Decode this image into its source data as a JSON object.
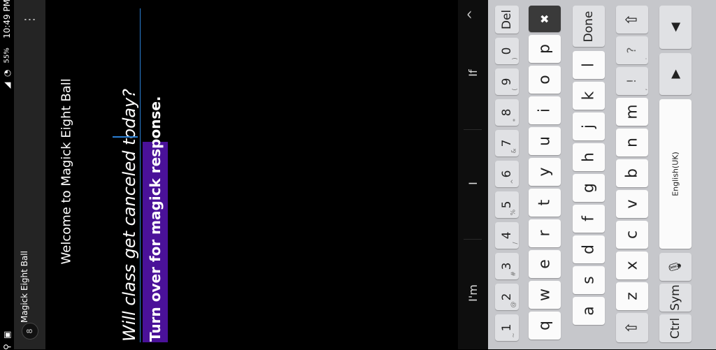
{
  "status_bar": {
    "time": "10:49 PM",
    "battery": "55%"
  },
  "app": {
    "title": "Magick Eight Ball",
    "logo_text": "8",
    "menu_icon": "overflow-menu-icon"
  },
  "content": {
    "welcome": "Welcome to Magick Eight Ball",
    "question": "Will class get canceled today?",
    "response_button": "Turn over for magick response."
  },
  "colors": {
    "button_bg": "#4a1199",
    "cursor": "#2a7fd4"
  },
  "suggestions": {
    "items": [
      "I'm",
      "I",
      "If"
    ],
    "collapse_icon": "chevron-up-icon"
  },
  "keyboard": {
    "row_numbers": [
      {
        "main": "1",
        "sub": "~"
      },
      {
        "main": "2",
        "sub": "@"
      },
      {
        "main": "3",
        "sub": "#"
      },
      {
        "main": "4",
        "sub": "/"
      },
      {
        "main": "5",
        "sub": "%"
      },
      {
        "main": "6",
        "sub": "^"
      },
      {
        "main": "7",
        "sub": "&"
      },
      {
        "main": "8",
        "sub": "*"
      },
      {
        "main": "9",
        "sub": "("
      },
      {
        "main": "0",
        "sub": ")"
      },
      {
        "main": "Del",
        "sub": ""
      }
    ],
    "row_qwerty": [
      "q",
      "w",
      "e",
      "r",
      "t",
      "y",
      "u",
      "i",
      "o",
      "p"
    ],
    "row_asdf": [
      "a",
      "s",
      "d",
      "f",
      "g",
      "h",
      "j",
      "k",
      "l"
    ],
    "row_zxcv": [
      "z",
      "x",
      "c",
      "v",
      "b",
      "n",
      "m"
    ],
    "punct_keys": [
      {
        "main": "!",
        "sub": ","
      },
      {
        "main": "?",
        "sub": "."
      }
    ],
    "done": "Done",
    "ctrl": "Ctrl",
    "sym": "Sym",
    "space_label": "English(UK)",
    "backspace_icon": "backspace-icon",
    "shift_icon": "shift-icon",
    "mic_icon": "mic-settings-icon",
    "up_icon": "cursor-up-icon",
    "down_icon": "cursor-down-icon"
  }
}
